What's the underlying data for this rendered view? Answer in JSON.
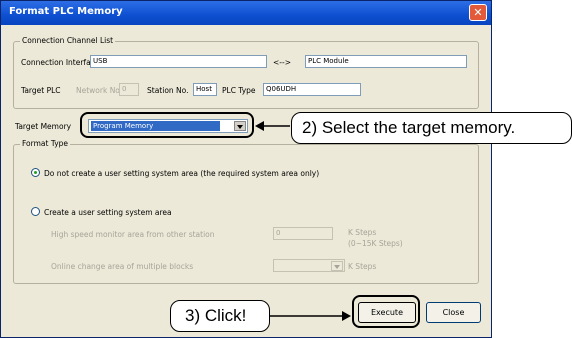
{
  "window": {
    "title": "Format PLC Memory",
    "close_glyph": "✕"
  },
  "connection": {
    "legend": "Connection Channel List",
    "interface_label": "Connection Interface",
    "interface_value": "USB",
    "arrow": "<-->",
    "module_value": "PLC Module",
    "target_plc_label": "Target PLC",
    "network_label": "Network No.",
    "network_value": "0",
    "station_label": "Station No.",
    "station_value": "Host",
    "plc_type_label": "PLC Type",
    "plc_type_value": "Q06UDH"
  },
  "target_memory": {
    "label": "Target Memory",
    "value": "Program Memory"
  },
  "format_type": {
    "legend": "Format Type",
    "option1": "Do not create a user setting system area (the required system area only)",
    "option2": "Create a user setting system area",
    "selected": "option1",
    "high_speed_label": "High speed monitor area from other station",
    "high_speed_value": "0",
    "high_speed_unit": "K Steps",
    "high_speed_range": "(0~15K Steps)",
    "online_change_label": "Online change area of multiple blocks",
    "online_change_unit": "K Steps"
  },
  "buttons": {
    "execute": "Execute",
    "close": "Close"
  },
  "annotations": {
    "step2": "2) Select the target memory.",
    "step3": "3) Click!"
  }
}
